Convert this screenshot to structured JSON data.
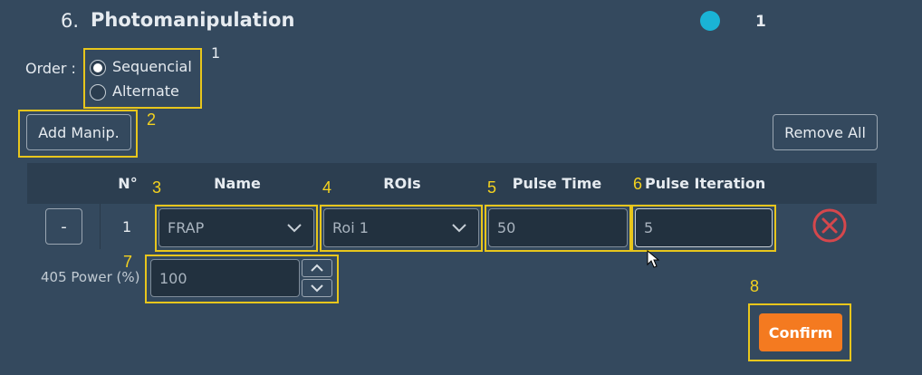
{
  "section": {
    "number": "6.",
    "title": "Photomanipulation",
    "count": "1",
    "status_dot_color": "#1ab4d6"
  },
  "order": {
    "label": "Order :",
    "options": [
      {
        "label": "Sequencial",
        "selected": true
      },
      {
        "label": "Alternate",
        "selected": false
      }
    ]
  },
  "buttons": {
    "add": "Add Manip.",
    "remove_all": "Remove All",
    "confirm": "Confirm",
    "row_minus": "-"
  },
  "table": {
    "headers": [
      "N°",
      "Name",
      "ROIs",
      "Pulse Time",
      "Pulse Iteration"
    ],
    "rows": [
      {
        "n": "1",
        "name": "FRAP",
        "roi": "Roi 1",
        "pulse_time": "50",
        "pulse_iteration": "5"
      }
    ]
  },
  "power": {
    "label": "405 Power (%)",
    "value": "100"
  },
  "annotations": [
    "1",
    "2",
    "3",
    "4",
    "5",
    "6",
    "7",
    "8"
  ],
  "colors": {
    "background": "#34495e",
    "header_bar": "#2c3e50",
    "highlight": "#e8c61c",
    "confirm": "#f47a20",
    "delete": "#d5474c"
  }
}
